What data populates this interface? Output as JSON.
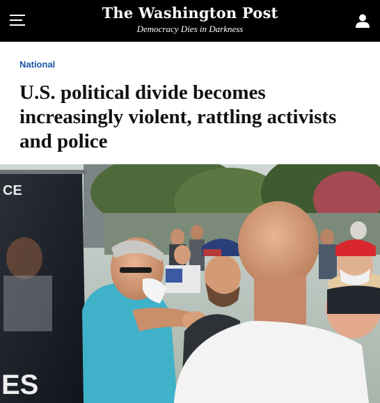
{
  "header": {
    "logo_text": "The Washington Post",
    "tagline": "Democracy Dies in Darkness",
    "menu_icon": "hamburger-menu-icon",
    "account_icon": "user-account-icon"
  },
  "article": {
    "section": "National",
    "headline": "U.S. political divide becomes increasingly violent, rattling activists and police"
  },
  "photo": {
    "sign_text_top": "CE",
    "sign_text_bottom": "ES"
  },
  "colors": {
    "header_bg": "#000000",
    "kicker": "#1955a5",
    "headline": "#111111"
  }
}
